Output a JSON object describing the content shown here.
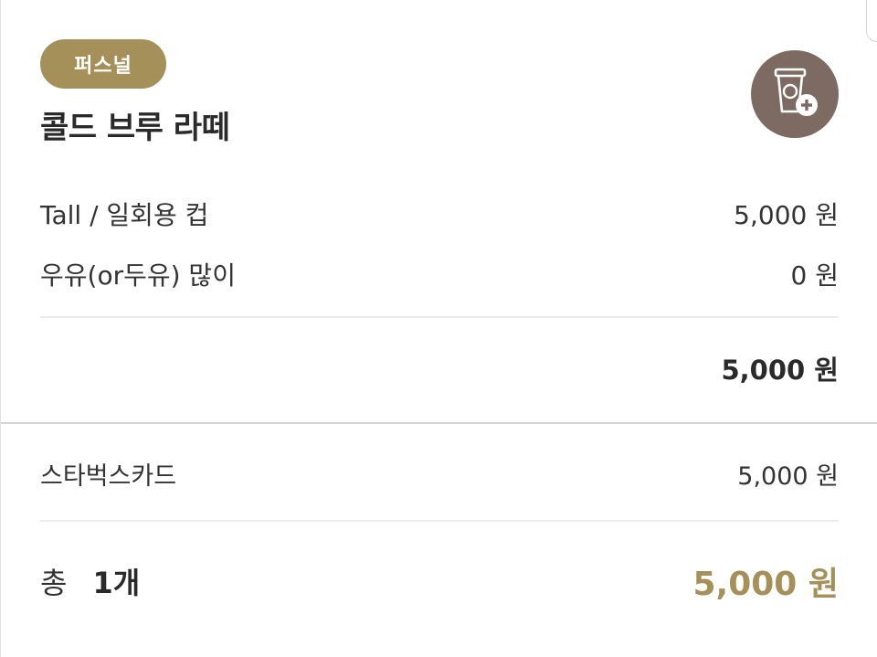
{
  "order": {
    "badge": "퍼스널",
    "product_name": "콜드 브루 라떼",
    "add_cup_icon": "cup-plus-icon",
    "options": [
      {
        "label": "Tall / 일회용 컵",
        "price": "5,000 원"
      },
      {
        "label": "우유(or두유) 많이",
        "price": "0 원"
      }
    ],
    "subtotal": "5,000 원"
  },
  "payment": {
    "method": "스타벅스카드",
    "amount": "5,000 원"
  },
  "total": {
    "label": "총",
    "count": "1개",
    "price": "5,000 원"
  },
  "colors": {
    "accent": "#a5905a",
    "icon_button": "#7d6b63"
  }
}
